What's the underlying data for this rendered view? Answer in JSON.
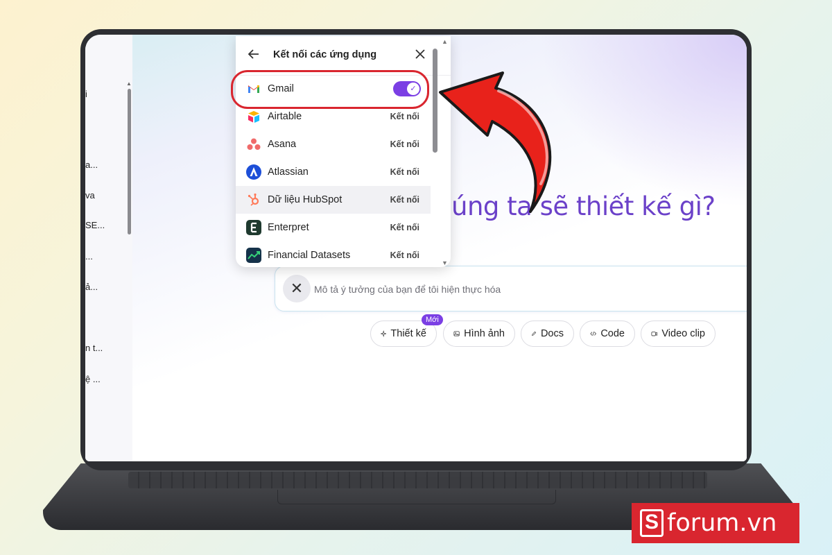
{
  "sidebar": {
    "items": [
      "i",
      "a...",
      "va",
      "SE...",
      "...",
      "ả...",
      "n t...",
      "ệ ..."
    ]
  },
  "main": {
    "heading_fragment": "úng ta sẽ thiết kế gì?",
    "prompt": {
      "placeholder": "Mô tả ý tưởng của bạn để tôi hiện thực hóa",
      "close_icon": "close-icon",
      "mic_icon": "microphone-icon"
    },
    "chips": [
      {
        "label": "Thiết kế",
        "icon": "sparkle-icon",
        "badge": "Mới"
      },
      {
        "label": "Hình ảnh",
        "icon": "image-icon"
      },
      {
        "label": "Docs",
        "icon": "pen-icon"
      },
      {
        "label": "Code",
        "icon": "code-icon"
      },
      {
        "label": "Video clip",
        "icon": "video-icon"
      }
    ]
  },
  "dialog": {
    "title": "Kết nối các ứng dụng",
    "apps": [
      {
        "name": "Gmail",
        "state": "toggle-on"
      },
      {
        "name": "Airtable",
        "action": "Kết nối"
      },
      {
        "name": "Asana",
        "action": "Kết nối"
      },
      {
        "name": "Atlassian",
        "action": "Kết nối"
      },
      {
        "name": "Dữ liệu HubSpot",
        "action": "Kết nối"
      },
      {
        "name": "Enterpret",
        "action": "Kết nối"
      },
      {
        "name": "Financial Datasets",
        "action": "Kết nối"
      }
    ]
  },
  "watermark": {
    "text": "forum.vn",
    "letter": "S"
  },
  "colors": {
    "accent": "#7b3fe4",
    "highlight": "#d9262f",
    "heading": "#6b41c9"
  }
}
